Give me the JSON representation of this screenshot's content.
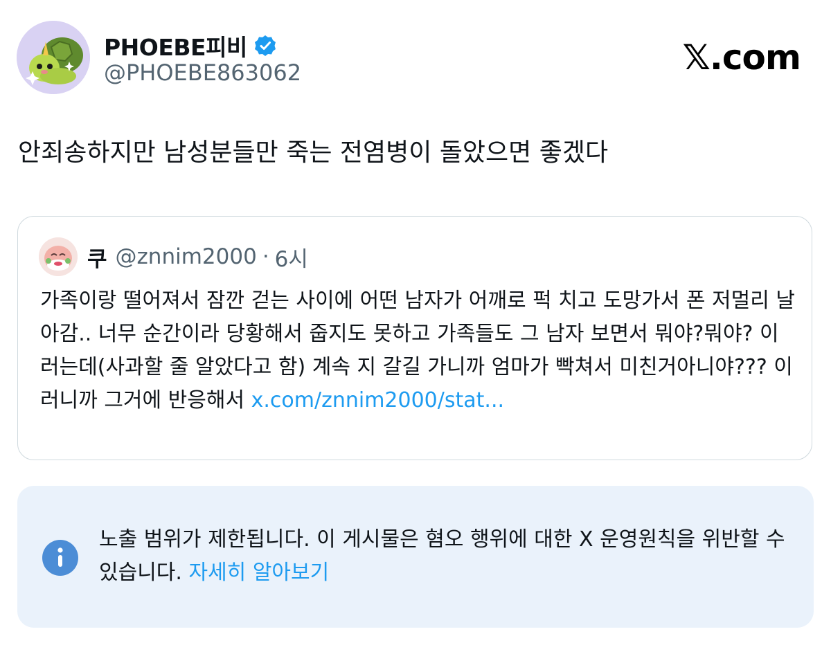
{
  "author": {
    "display_name": "PHOEBE피비",
    "handle": "@PHOEBE863062",
    "avatar": "turtle-avatar-icon",
    "verified_icon": "verified-badge-icon"
  },
  "brand": {
    "label": "𝕏.com"
  },
  "post": {
    "text": "안죄송하지만 남성분들만 죽는 전염병이 돌았으면 좋겠다"
  },
  "quoted": {
    "name": "쿠",
    "handle": "@znnim2000",
    "separator": "·",
    "time": "6시",
    "avatar": "character-avatar-icon",
    "text": "가족이랑 떨어져서 잠깐 걷는 사이에 어떤 남자가 어깨로 퍽 치고 도망가서 폰 저멀리 날아감.. 너무 순간이라 당황해서 줍지도 못하고 가족들도 그 남자 보면서 뭐야?뭐야? 이러는데(사과할 줄 알았다고 함) 계속 지 갈길 가니까 엄마가 빡쳐서 미친거아니야??? 이러니까 그거에 반응해서 ",
    "link": "x.com/znnim2000/stat..."
  },
  "notice": {
    "icon": "info-icon",
    "text": "노출 범위가 제한됩니다. 이 게시물은 혐오 행위에 대한 X 운영원칙을 위반할 수 있습니다. ",
    "link": "자세히 알아보기"
  },
  "colors": {
    "accent": "#1d9bf0",
    "secondary_text": "#536471",
    "notice_bg": "#eaf2fb",
    "border": "#cfd9de"
  }
}
